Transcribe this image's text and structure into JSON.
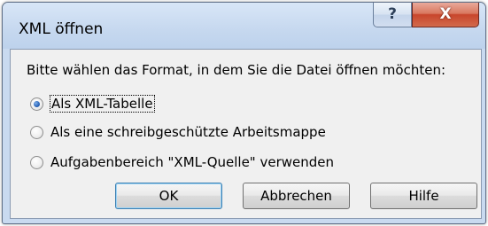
{
  "window": {
    "title": "XML öffnen",
    "help_glyph": "?",
    "close_glyph": "X"
  },
  "dialog": {
    "prompt": "Bitte wählen das Format, in dem Sie die Datei öffnen möchten:",
    "options": [
      {
        "label": "Als XML-Tabelle",
        "checked": true
      },
      {
        "label": "Als eine schreibgeschützte Arbeitsmappe",
        "checked": false
      },
      {
        "label": "Aufgabenbereich \"XML-Quelle\" verwenden",
        "checked": false
      }
    ]
  },
  "buttons": {
    "ok": "OK",
    "cancel": "Abbrechen",
    "help": "Hilfe"
  },
  "colors": {
    "title_bar": "#c9daf0",
    "close_button": "#c8462c",
    "client_background": "#f0f0f0",
    "default_button_border": "#3c7fb1"
  },
  "icons": [
    "help-icon",
    "close-icon",
    "radio-checked",
    "radio-unchecked"
  ]
}
